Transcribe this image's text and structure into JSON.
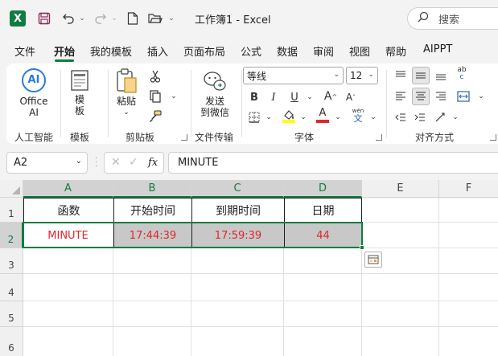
{
  "titlebar": {
    "logo": "X",
    "title": "工作簿1  -  Excel",
    "search_placeholder": "搜索",
    "icons": [
      "excel-logo-icon",
      "save-icon",
      "undo-icon",
      "redo-icon",
      "new-file-icon",
      "open-folder-icon"
    ]
  },
  "menu": {
    "items": [
      "文件",
      "开始",
      "我的模板",
      "插入",
      "页面布局",
      "公式",
      "数据",
      "审阅",
      "视图",
      "帮助",
      "AIPPT"
    ],
    "active_index": 1
  },
  "ribbon": {
    "ai": {
      "icon_text": "AI",
      "label": "Office\nAI",
      "label_line1": "Office",
      "label_line2": "AI",
      "group": "人工智能"
    },
    "template": {
      "label_line1": "模",
      "label_line2": "板",
      "group": "模板"
    },
    "clipboard": {
      "paste": "粘贴",
      "group": "剪贴板"
    },
    "transfer": {
      "label_line1": "发送",
      "label_line2": "到微信",
      "group": "文件传输"
    },
    "font": {
      "name": "等线",
      "size": "12",
      "bold": "B",
      "italic": "I",
      "underline": "U",
      "grow": "A",
      "shrink": "A",
      "font_color_letter": "A",
      "wen": "wén",
      "wen_char": "文",
      "group": "字体"
    },
    "align": {
      "group": "对齐方式",
      "abc": "ab",
      "c": "c"
    }
  },
  "formula": {
    "cell_ref": "A2",
    "fx": "fx",
    "content": "MINUTE"
  },
  "sheet": {
    "columns": [
      "A",
      "B",
      "C",
      "D",
      "E",
      "F"
    ],
    "rows": [
      "1",
      "2",
      "3",
      "4",
      "5",
      "6"
    ],
    "headers": [
      "函数",
      "开始时间",
      "到期时间",
      "日期"
    ],
    "row2": [
      "MINUTE",
      "17:44:39",
      "17:59:39",
      "44"
    ]
  },
  "colors": {
    "excel_green": "#107c41",
    "text_red": "#e0262b",
    "data_fill": "#c8c8c8"
  }
}
